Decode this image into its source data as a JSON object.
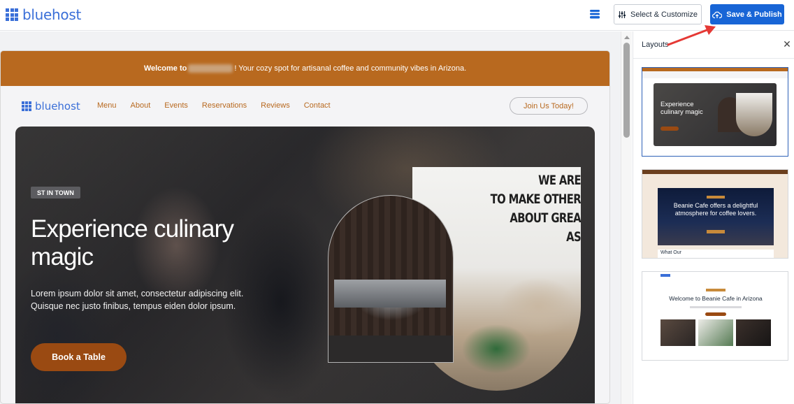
{
  "header": {
    "brand": "bluehost",
    "select_customize": "Select & Customize",
    "save_publish": "Save & Publish"
  },
  "site": {
    "welcome_prefix": "Welcome to",
    "welcome_suffix": "! Your cozy spot for artisanal coffee and community vibes in Arizona.",
    "brand": "bluehost",
    "nav": [
      "Menu",
      "About",
      "Events",
      "Reservations",
      "Reviews",
      "Contact"
    ],
    "join_button": "Join Us Today!",
    "hero": {
      "badge": "ST IN TOWN",
      "title": "Experience culinary magic",
      "description": "Lorem ipsum dolor sit amet, consectetur adipiscing elit. Quisque nec justo finibus, tempus eiden dolor ipsum.",
      "book_button": "Book a Table",
      "wall_text": [
        "WE ARE",
        "TO MAKE OTHER",
        "ABOUT GREA",
        "AS"
      ]
    }
  },
  "panel": {
    "title": "Layouts",
    "layouts": [
      {
        "title": "Experience culinary magic"
      },
      {
        "title": "Beanie Cafe offers a delightful atmosphere for coffee lovers.",
        "lower": "What Our"
      },
      {
        "title": "Welcome to Beanie Cafe in Arizona"
      }
    ]
  },
  "colors": {
    "accent": "#1865d6",
    "brand": "#3a6fd8",
    "site_primary": "#b8691f",
    "book_button": "#9a4a12",
    "annotation_arrow": "#e53935"
  }
}
